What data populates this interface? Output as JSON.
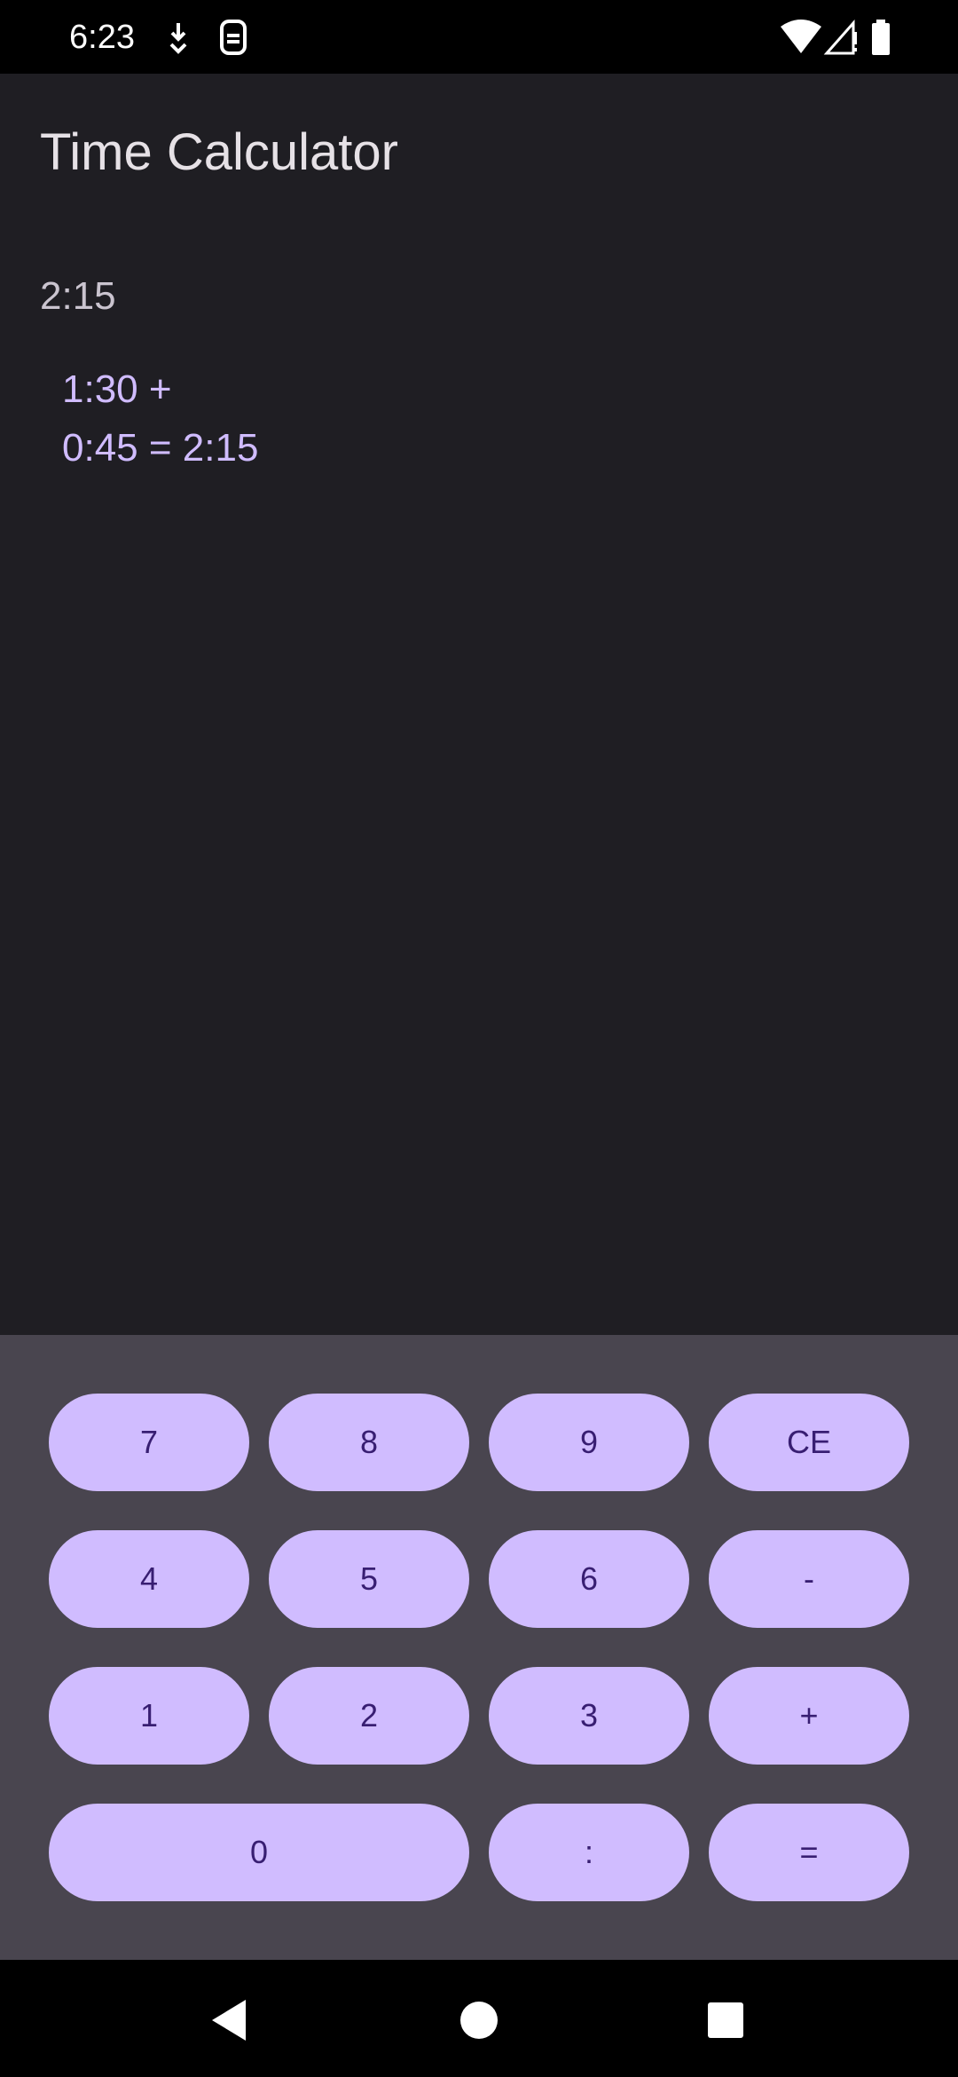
{
  "status_bar": {
    "time": "6:23",
    "icons_left": [
      "download-icon",
      "sim-icon"
    ],
    "icons_right": [
      "wifi-icon",
      "cell-signal-icon",
      "battery-icon"
    ]
  },
  "app": {
    "title": "Time Calculator",
    "current_value": "2:15",
    "history": [
      "1:30 +",
      "0:45 = 2:15"
    ]
  },
  "keypad": {
    "row1": [
      "7",
      "8",
      "9",
      "CE"
    ],
    "row2": [
      "4",
      "5",
      "6",
      "-"
    ],
    "row3": [
      "1",
      "2",
      "3",
      "+"
    ],
    "row4": [
      "0",
      ":",
      "="
    ]
  },
  "nav_bar": {
    "buttons": [
      "back-icon",
      "home-icon",
      "recents-icon"
    ]
  },
  "colors": {
    "background": "#1f1e23",
    "keypad_background": "#49454f",
    "key_fill": "#d0bcff",
    "key_text": "#381e72",
    "history_text": "#d0bcff"
  }
}
